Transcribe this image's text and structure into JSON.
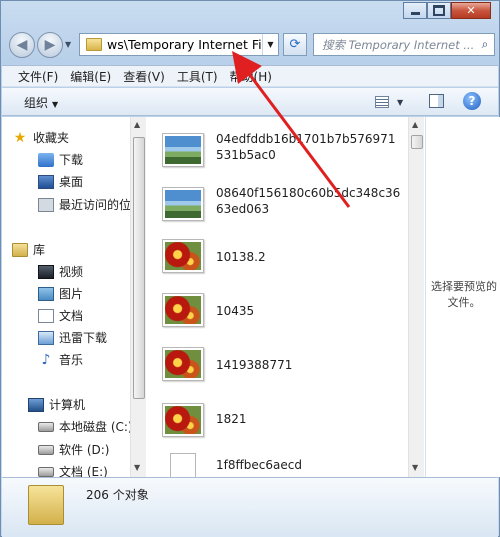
{
  "window": {
    "caption": {
      "minimize": "",
      "maximize": "",
      "close": ""
    }
  },
  "nav": {
    "back_glyph": "◀",
    "forward_glyph": "▶",
    "dropdown_glyph": "▼",
    "address": "ws\\Temporary Internet Files",
    "address_drop_glyph": "▼",
    "refresh_glyph": "⟳",
    "search_placeholder": "搜索 Temporary Internet ...",
    "search_glyph": "⌕"
  },
  "menubar": {
    "items": [
      "文件(F)",
      "编辑(E)",
      "查看(V)",
      "工具(T)",
      "帮助(H)"
    ]
  },
  "cmdbar": {
    "organize": "组织",
    "caret": "▼",
    "help_glyph": "?"
  },
  "navpane": {
    "favorites": "收藏夹",
    "favorites_items": [
      "下载",
      "桌面",
      "最近访问的位置"
    ],
    "libraries": "库",
    "library_items": [
      "视频",
      "图片",
      "文档",
      "迅雷下载",
      "音乐"
    ],
    "computer": "计算机",
    "computer_items": [
      "本地磁盘 (C:)",
      "软件 (D:)",
      "文档 (E:)"
    ],
    "scroll_up": "▲",
    "scroll_down": "▼"
  },
  "files": [
    {
      "name": "04edfddb16b1701b7b576971531b5ac0",
      "kind": "landscape"
    },
    {
      "name": "08640f156180c60b5dc348c3663ed063",
      "kind": "landscape"
    },
    {
      "name": "10138.2",
      "kind": "flower"
    },
    {
      "name": "10435",
      "kind": "flower"
    },
    {
      "name": "1419388771",
      "kind": "flower"
    },
    {
      "name": "1821",
      "kind": "flower"
    },
    {
      "name": "1f8ffbec6aecd",
      "kind": "blank"
    }
  ],
  "preview": {
    "message": "选择要预览的文件。"
  },
  "details": {
    "count": "206 个对象"
  },
  "annotation": {
    "color": "#e02020"
  }
}
